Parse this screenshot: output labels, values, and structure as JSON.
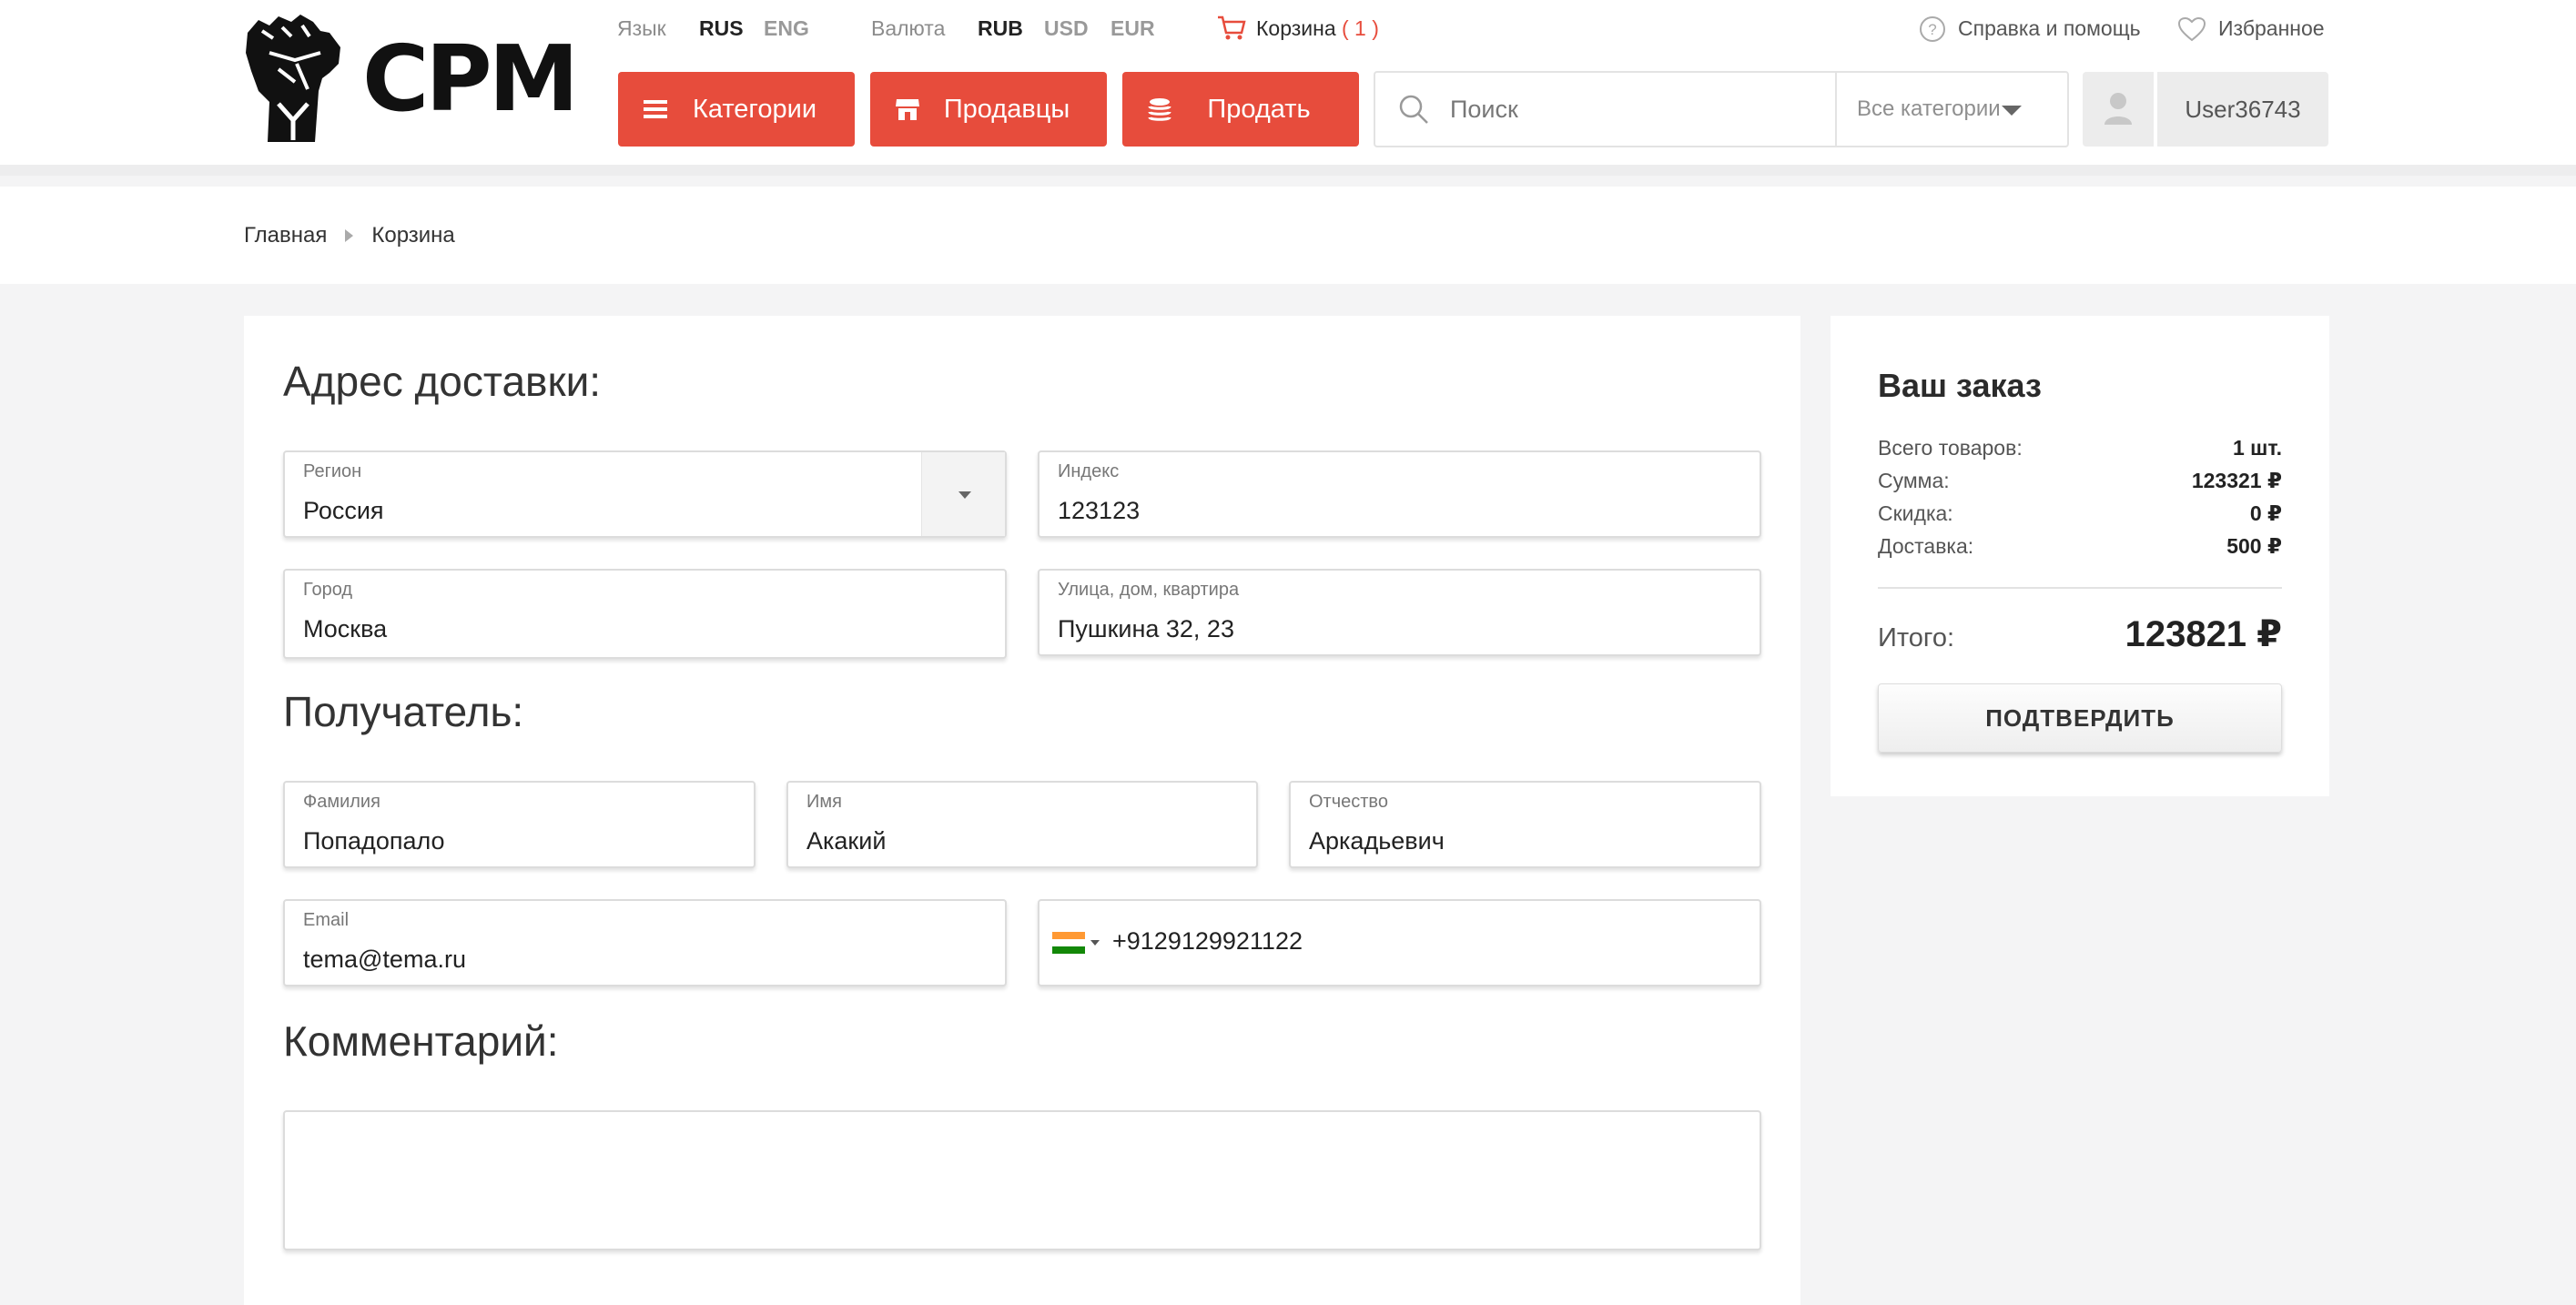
{
  "logo": {
    "text": "CPM"
  },
  "topbar": {
    "language_label": "Язык",
    "languages": [
      "RUS",
      "ENG"
    ],
    "currency_label": "Валюта",
    "currencies": [
      "RUB",
      "USD",
      "EUR"
    ],
    "cart_label": "Корзина",
    "cart_count": "( 1 )",
    "help_label": "Справка и помощь",
    "favorites_label": "Избранное"
  },
  "nav": {
    "categories": "Категории",
    "sellers": "Продавцы",
    "sell": "Продать"
  },
  "search": {
    "placeholder": "Поиск",
    "category_select": "Все категории"
  },
  "user": {
    "name": "User36743"
  },
  "breadcrumb": {
    "home": "Главная",
    "current": "Корзина"
  },
  "form": {
    "delivery_title": "Адрес доставки:",
    "region": {
      "label": "Регион",
      "value": "Россия"
    },
    "index": {
      "label": "Индекс",
      "value": "123123"
    },
    "city": {
      "label": "Город",
      "value": "Москва"
    },
    "street": {
      "label": "Улица, дом, квартира",
      "value": "Пушкина 32, 23"
    },
    "recipient_title": "Получатель:",
    "lastname": {
      "label": "Фамилия",
      "value": "Попадопало"
    },
    "firstname": {
      "label": "Имя",
      "value": "Акакий"
    },
    "patronymic": {
      "label": "Отчество",
      "value": "Аркадьевич"
    },
    "email": {
      "label": "Email",
      "value": "tema@tema.ru"
    },
    "phone": {
      "value": "+9129129921122",
      "flag_colors": [
        "#ff9933",
        "#ffffff",
        "#138808"
      ]
    },
    "comment_title": "Комментарий:",
    "comment_value": ""
  },
  "order": {
    "title": "Ваш заказ",
    "rows": [
      {
        "label": "Всего товаров:",
        "value": "1 шт."
      },
      {
        "label": "Сумма:",
        "value": "123321 ₽"
      },
      {
        "label": "Скидка:",
        "value": "0 ₽"
      },
      {
        "label": "Доставка:",
        "value": "500 ₽"
      }
    ],
    "total_label": "Итого:",
    "total_value": "123821 ₽",
    "confirm_label": "ПОДТВЕРДИТЬ"
  },
  "colors": {
    "accent": "#e74c3c",
    "background": "#f4f4f5"
  }
}
